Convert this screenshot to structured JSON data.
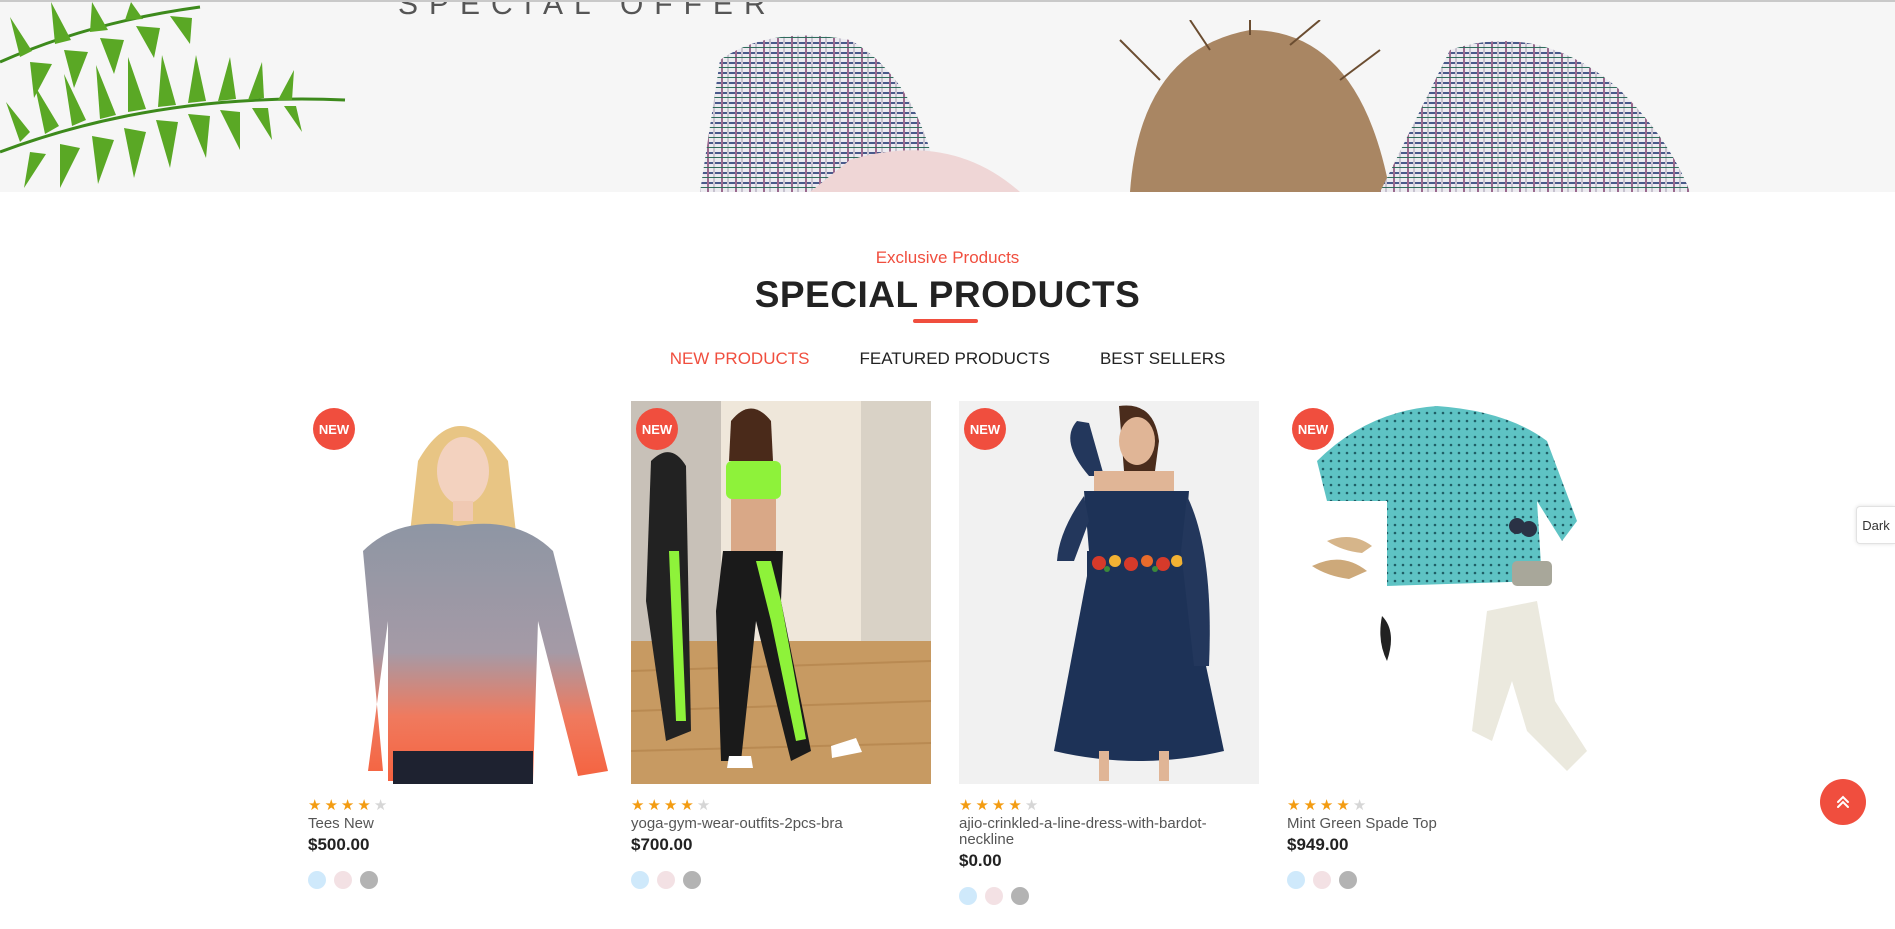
{
  "banner": {
    "title": "SPECIAL OFFER"
  },
  "section": {
    "subtitle": "Exclusive Products",
    "title": "SPECIAL PRODUCTS"
  },
  "tabs": [
    {
      "label": "NEW PRODUCTS",
      "active": true
    },
    {
      "label": "FEATURED PRODUCTS",
      "active": false
    },
    {
      "label": "BEST SELLERS",
      "active": false
    }
  ],
  "products": [
    {
      "badge": "NEW",
      "rating": 4,
      "name": "Tees New",
      "price": "$500.00",
      "swatches": [
        "#cfe9fb",
        "#f3e1e4",
        "#b3b3b3"
      ]
    },
    {
      "badge": "NEW",
      "rating": 4,
      "name": "yoga-gym-wear-outfits-2pcs-bra",
      "price": "$700.00",
      "swatches": [
        "#cfe9fb",
        "#f3e1e4",
        "#b3b3b3"
      ]
    },
    {
      "badge": "NEW",
      "rating": 4,
      "name": "ajio-crinkled-a-line-dress-with-bardot-neckline",
      "price": "$0.00",
      "swatches": [
        "#cfe9fb",
        "#f3e1e4",
        "#b3b3b3"
      ]
    },
    {
      "badge": "NEW",
      "rating": 4,
      "name": "Mint Green Spade Top",
      "price": "$949.00",
      "swatches": [
        "#cfe9fb",
        "#f3e1e4",
        "#b3b3b3"
      ]
    }
  ],
  "widgets": {
    "dark_toggle": "Dark",
    "scroll_top_icon": "double-chevron-up-icon"
  },
  "colors": {
    "accent": "#f04e3e",
    "star": "#f39c12"
  }
}
